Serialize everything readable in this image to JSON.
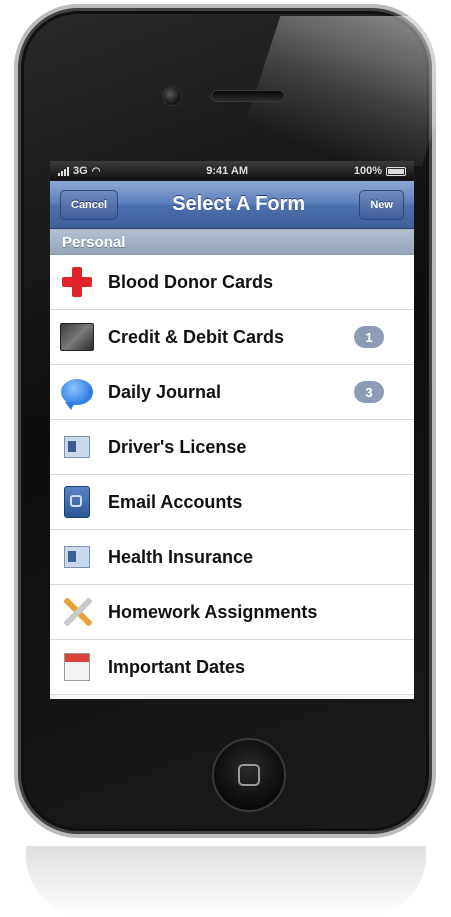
{
  "status_bar": {
    "carrier": "3G",
    "time": "9:41 AM",
    "battery": "100%"
  },
  "nav": {
    "cancel_label": "Cancel",
    "title": "Select A Form",
    "new_label": "New"
  },
  "section": {
    "header": "Personal"
  },
  "items": [
    {
      "label": "Blood Donor Cards",
      "icon": "red-cross-icon",
      "badge": ""
    },
    {
      "label": "Credit & Debit Cards",
      "icon": "credit-card-icon",
      "badge": "1"
    },
    {
      "label": "Daily Journal",
      "icon": "speech-bubble-icon",
      "badge": "3"
    },
    {
      "label": "Driver's License",
      "icon": "id-card-icon",
      "badge": ""
    },
    {
      "label": "Email Accounts",
      "icon": "email-icon",
      "badge": ""
    },
    {
      "label": "Health Insurance",
      "icon": "id-card-icon",
      "badge": ""
    },
    {
      "label": "Homework Assignments",
      "icon": "pencil-ruler-icon",
      "badge": ""
    },
    {
      "label": "Important Dates",
      "icon": "calendar-icon",
      "badge": ""
    }
  ],
  "colors": {
    "nav_bar": "#4b70ae",
    "section_header": "#96a4b8",
    "badge": "#8e9bb6",
    "phone_body": "#111111"
  }
}
